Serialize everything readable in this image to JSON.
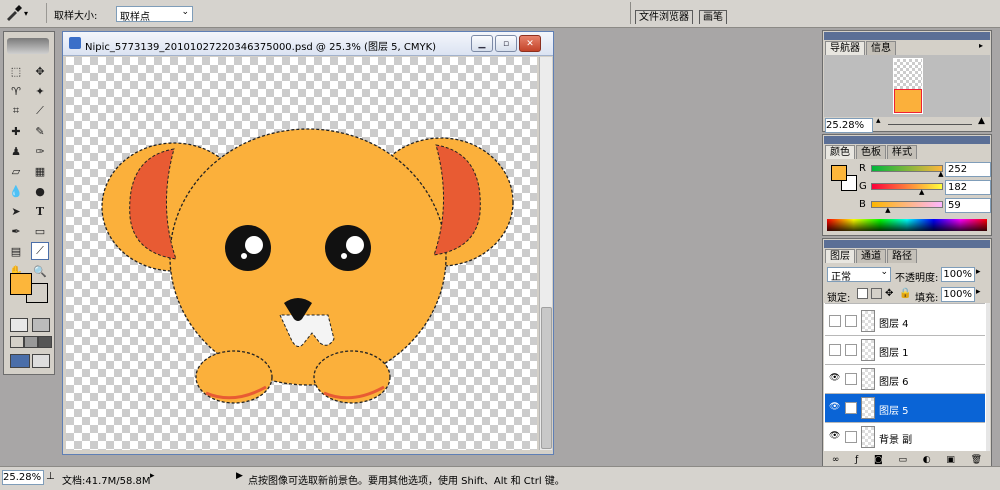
{
  "options_bar": {
    "sample_size_label": "取样大小:",
    "sample_size_value": "取样点",
    "tab_file_browser": "文件浏览器",
    "tab_brushes": "画笔"
  },
  "document": {
    "title": "Nipic_5773139_20101027220346375000.psd @ 25.3% (图层 5, CMYK)"
  },
  "navigator": {
    "tabs": [
      "导航器",
      "信息"
    ],
    "zoom": "25.28%"
  },
  "color_panel": {
    "tabs": [
      "颜色",
      "色板",
      "样式"
    ],
    "channels": [
      {
        "label": "R",
        "value": "252",
        "fraction": 0.988
      },
      {
        "label": "G",
        "value": "182",
        "fraction": 0.714
      },
      {
        "label": "B",
        "value": "59",
        "fraction": 0.231
      }
    ],
    "foreground_color": "#fcb63b",
    "background_color": "#ffffff"
  },
  "layers_panel": {
    "tabs": [
      "图层",
      "通道",
      "路径"
    ],
    "blend_mode": "正常",
    "opacity_label": "不透明度:",
    "opacity_value": "100%",
    "lock_label": "锁定:",
    "fill_label": "填充:",
    "fill_value": "100%",
    "layers": [
      {
        "name": "图层 4",
        "visible": false,
        "selected": false
      },
      {
        "name": "图层 1",
        "visible": false,
        "selected": false
      },
      {
        "name": "图层 6",
        "visible": true,
        "selected": false
      },
      {
        "name": "图层 5",
        "visible": true,
        "selected": true
      },
      {
        "name": "背景 副",
        "visible": true,
        "selected": false
      }
    ]
  },
  "status_bar": {
    "zoom": "25.28%",
    "doc_size": "文档:41.7M/58.8M",
    "hint": "点按图像可选取新前景色。要用其他选项，使用 Shift、Alt 和 Ctrl 键。"
  },
  "colors": {
    "bear_body": "#fbb03b",
    "bear_ear_inner": "#e85b33",
    "selection_blue": "#0a64d6"
  }
}
